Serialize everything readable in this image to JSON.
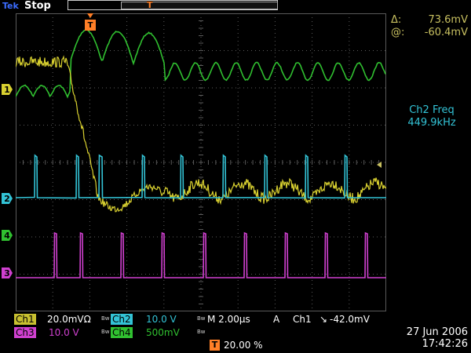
{
  "top": {
    "brand": "Tek",
    "status": "Stop",
    "trigger_symbol": "T"
  },
  "markers": {
    "ch1": "1",
    "ch2": "2",
    "ch3": "3",
    "ch4": "4",
    "trigger": "T"
  },
  "cursor": {
    "delta_label": "Δ:",
    "delta_value": "73.6mV",
    "at_label": "@:",
    "at_value": "-60.4mV"
  },
  "measurement": {
    "name": "Ch2 Freq",
    "value": "449.9kHz"
  },
  "bottom": {
    "ch1_label": "Ch1",
    "ch1_scale": "20.0mVΩ",
    "ch1_bw": "Bw",
    "ch2_label": "Ch2",
    "ch2_scale": "10.0 V",
    "ch2_bw": "Bw",
    "ch3_label": "Ch3",
    "ch3_scale": "10.0 V",
    "ch3_bw": "Bw",
    "ch4_label": "Ch4",
    "ch4_scale": "500mV",
    "ch4_bw": "Bw",
    "timebase": "M 2.00µs",
    "trig_mode": "A",
    "trig_source": "Ch1",
    "trig_slope": "↘",
    "trig_level": "-42.0mV",
    "trig_pos_symbol": "T",
    "trig_pos": "20.00 %",
    "date": "27 Jun  2006",
    "time": "17:42:26"
  },
  "colors": {
    "ch1": "#d8d030",
    "ch2": "#33c3d6",
    "ch3": "#d040d0",
    "ch4": "#30c030",
    "grid": "#5a5a5a",
    "trigger": "#ff7f27"
  }
}
